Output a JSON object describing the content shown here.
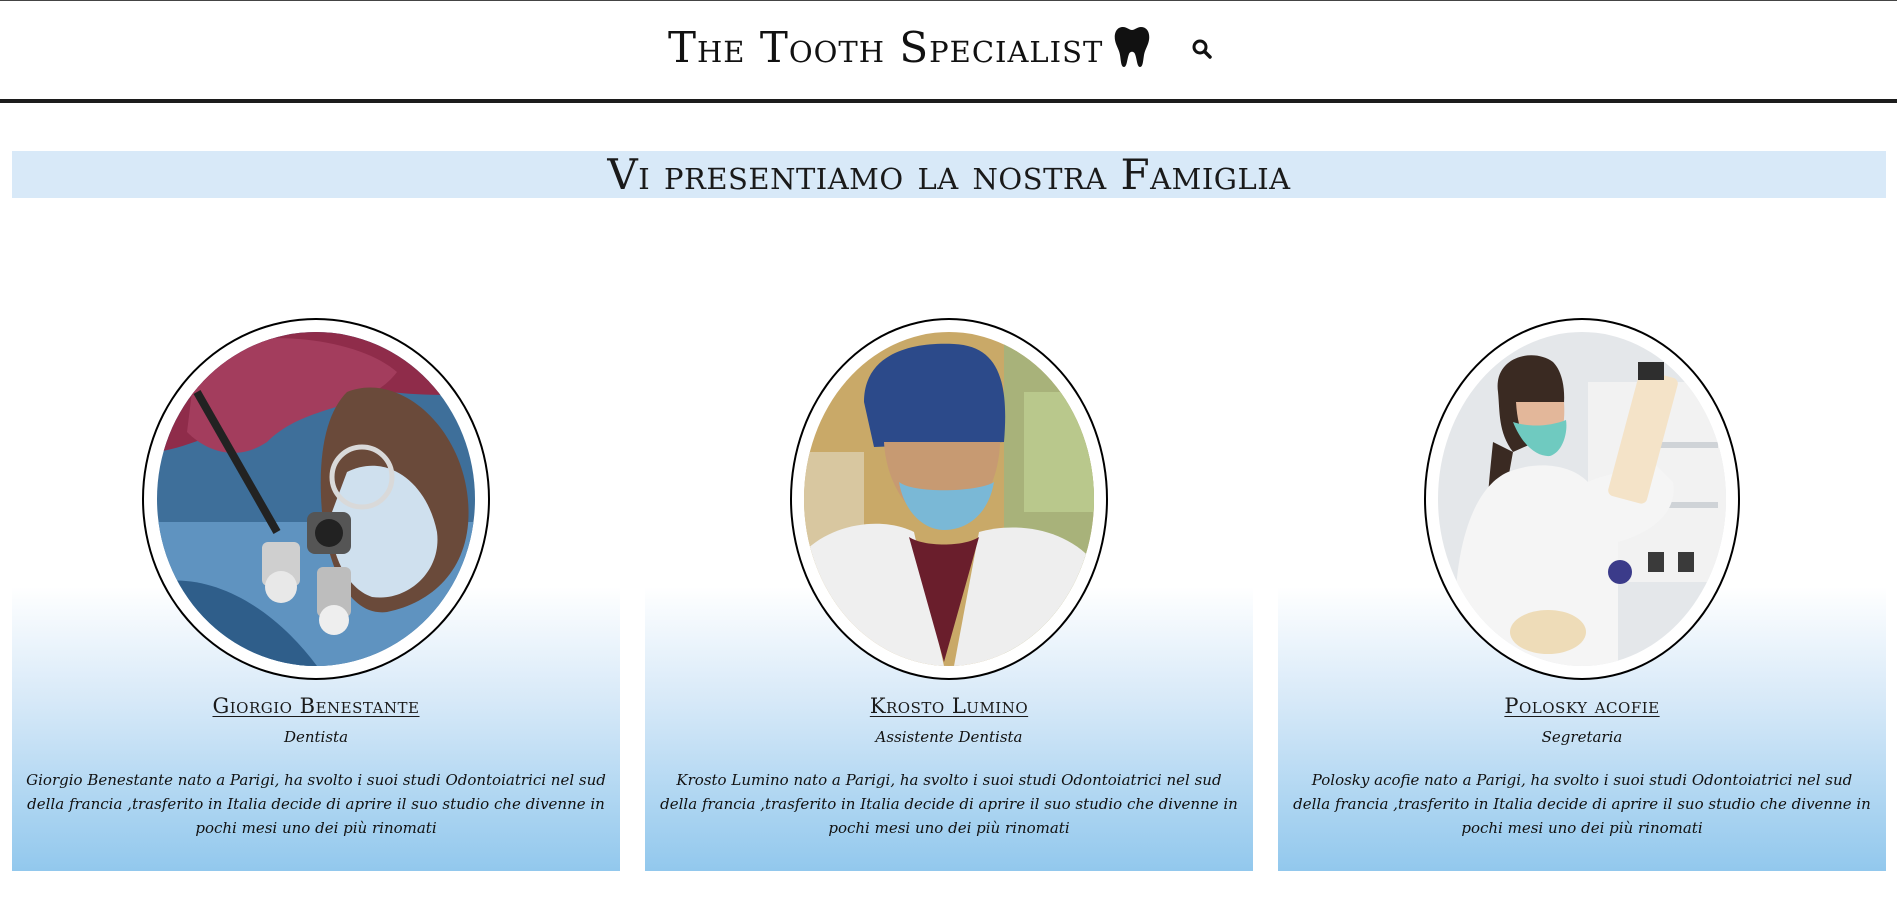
{
  "header": {
    "brand": "The Tooth Specialist",
    "icons": [
      "tooth-icon",
      "search-icon"
    ]
  },
  "section": {
    "title": "Vi presentiamo la nostra Famiglia"
  },
  "team": [
    {
      "name": "Giorgio Benestante",
      "role": "Dentista",
      "description": "Giorgio Benestante nato a Parigi, ha svolto i suoi studi Odontoiatrici nel sud della francia ,trasferito in Italia decide di aprire il suo studio che divenne in pochi mesi uno dei più rinomati"
    },
    {
      "name": "Krosto Lumino",
      "role": "Assistente Dentista",
      "description": "Krosto Lumino nato a Parigi, ha svolto i suoi studi Odontoiatrici nel sud della francia ,trasferito in Italia decide di aprire il suo studio che divenne in pochi mesi uno dei più rinomati"
    },
    {
      "name": "Polosky acofie",
      "role": "Segretaria",
      "description": "Polosky acofie nato a Parigi, ha svolto i suoi studi Odontoiatrici nel sud della francia ,trasferito in Italia decide di aprire il suo studio che divenne in pochi mesi uno dei più rinomati"
    }
  ],
  "colors": {
    "title_band": "#d8e9f8",
    "card_gradient_top": "#ffffff",
    "card_gradient_bottom": "#92c8ed",
    "header_rule": "#1c1c1c"
  }
}
